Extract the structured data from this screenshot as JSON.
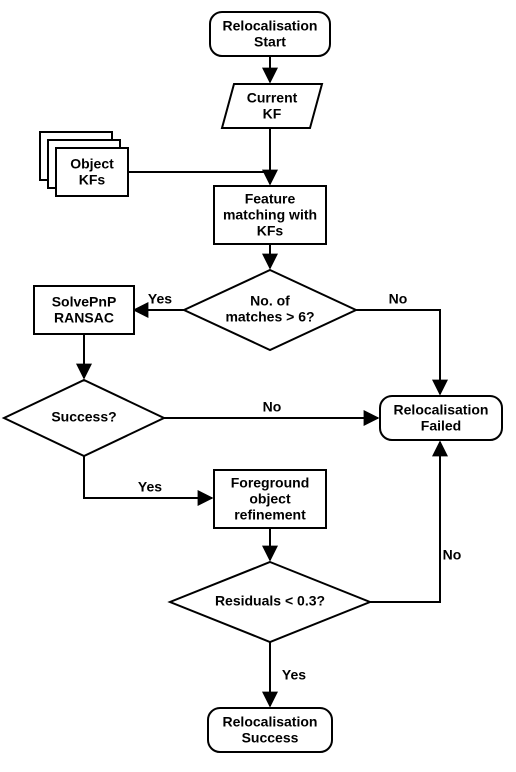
{
  "chart_data": {
    "type": "flowchart",
    "nodes": {
      "start": {
        "shape": "terminator",
        "text": [
          "Relocalisation",
          "Start"
        ]
      },
      "current_kf": {
        "shape": "parallelogram",
        "text": [
          "Current",
          "KF"
        ]
      },
      "object_kfs": {
        "shape": "stacked-rect",
        "text": [
          "Object",
          "KFs"
        ]
      },
      "feat_match": {
        "shape": "process",
        "text": [
          "Feature",
          "matching with",
          "KFs"
        ]
      },
      "dec_matches": {
        "shape": "decision",
        "text": [
          "No. of",
          "matches > 6?"
        ]
      },
      "solvepnp": {
        "shape": "process",
        "text": [
          "SolvePnP",
          "RANSAC"
        ]
      },
      "dec_success": {
        "shape": "decision",
        "text": [
          "Success?"
        ]
      },
      "fg_refine": {
        "shape": "process",
        "text": [
          "Foreground",
          "object",
          "refinement"
        ]
      },
      "dec_resid": {
        "shape": "decision",
        "text": [
          "Residuals < 0.3?"
        ]
      },
      "failed": {
        "shape": "terminator",
        "text": [
          "Relocalisation",
          "Failed"
        ]
      },
      "success": {
        "shape": "terminator",
        "text": [
          "Relocalisation",
          "Success"
        ]
      }
    },
    "edges": [
      {
        "from": "start",
        "to": "current_kf",
        "label": ""
      },
      {
        "from": "current_kf",
        "to": "feat_match",
        "label": ""
      },
      {
        "from": "object_kfs",
        "to": "feat_match",
        "label": ""
      },
      {
        "from": "feat_match",
        "to": "dec_matches",
        "label": ""
      },
      {
        "from": "dec_matches",
        "to": "solvepnp",
        "label": "Yes"
      },
      {
        "from": "dec_matches",
        "to": "failed",
        "label": "No"
      },
      {
        "from": "solvepnp",
        "to": "dec_success",
        "label": ""
      },
      {
        "from": "dec_success",
        "to": "fg_refine",
        "label": "Yes"
      },
      {
        "from": "dec_success",
        "to": "failed",
        "label": "No"
      },
      {
        "from": "fg_refine",
        "to": "dec_resid",
        "label": ""
      },
      {
        "from": "dec_resid",
        "to": "success",
        "label": "Yes"
      },
      {
        "from": "dec_resid",
        "to": "failed",
        "label": "No"
      }
    ]
  },
  "labels": {
    "yes": "Yes",
    "no": "No"
  }
}
